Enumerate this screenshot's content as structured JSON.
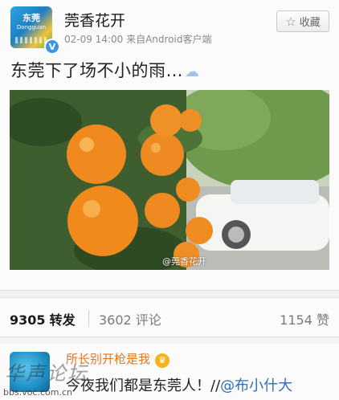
{
  "post": {
    "author": "莞香花开",
    "avatar_text_top": "东莞",
    "avatar_text_bottom": "Dongguan",
    "verified_mark": "V",
    "meta": "02-09 14:00  来自Android客户端",
    "favorite_label": "收藏",
    "text": "东莞下了场不小的雨…",
    "image_watermark": "@莞香花开"
  },
  "stats": {
    "reposts_count": "9305",
    "reposts_label": "转发",
    "comments_count": "3602",
    "comments_label": "评论",
    "likes_count": "1154",
    "likes_label": "赞"
  },
  "comment": {
    "author": "所长别开枪是我",
    "text_before": "今夜我们都是东莞人！//",
    "mention": "@布小什大"
  },
  "site": {
    "watermark": "华声论坛",
    "url": "bbs.voc.com.cn"
  },
  "icons": {
    "favorite": "star-icon",
    "weather": "cloud-icon",
    "badge": "crown-icon"
  }
}
